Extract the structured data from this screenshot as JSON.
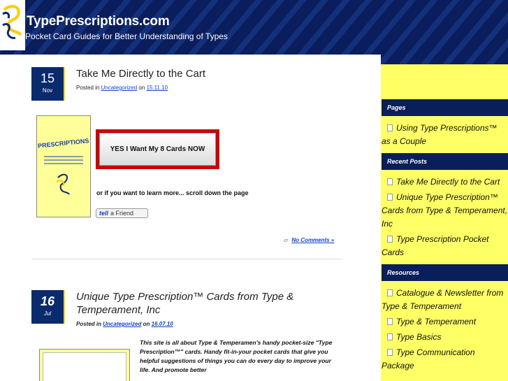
{
  "site": {
    "title": "TypePrescriptions.com",
    "tagline": "Pocket Card Guides for Better Understanding of Types"
  },
  "posts": [
    {
      "day": "15",
      "month": "Nov",
      "title": "Take Me Directly to the Cart",
      "posted_in_label": "Posted in",
      "category": "Uncategorized",
      "on_label": "on",
      "date": "15.11.10",
      "cta_label": "YES I Want My 8 Cards NOW",
      "learn_more": "or if you want to learn more... scroll down the page",
      "tell_label": "tell",
      "friend_label": "a Friend",
      "comments": "No Comments »"
    },
    {
      "day": "16",
      "month": "Jul",
      "title": "Unique Type Prescription™ Cards from Type &",
      "title_line2": "Temperament, Inc",
      "posted_in_label": "Posted in",
      "category": "Uncategorized",
      "on_label": "on",
      "date": "16.07.10",
      "excerpt": "This site is all about Type & Temperamen's handy pocket-size \"Type Prescription™\" cards. Handy fit-in-your pocket cards that give you helpful suggestions of things you can do every day to improve your life. And promote better"
    }
  ],
  "sidebar": {
    "pages_heading": "Pages",
    "pages": [
      "Using Type Prescriptions™ as a Couple"
    ],
    "recent_heading": "Recent Posts",
    "recent": [
      "Take Me Directly to the Cart",
      "Unique Type Prescription™ Cards from Type & Temperament, Inc",
      "Type Prescription Pocket Cards"
    ],
    "resources_heading": "Resources",
    "resources": [
      "Catalogue & Newsletter from Type & Temperament",
      "Type & Temperament",
      "Type Basics",
      "Type Communication Package"
    ]
  }
}
